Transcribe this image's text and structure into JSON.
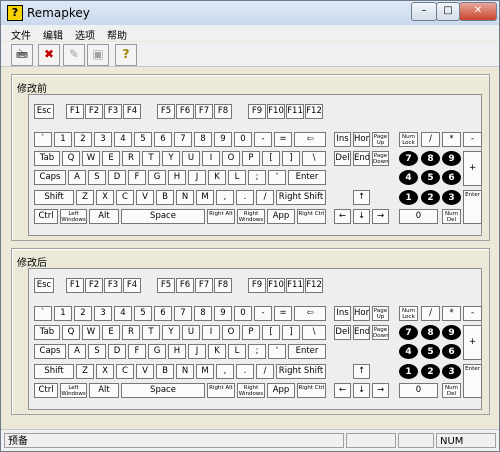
{
  "window": {
    "title": "Remapkey",
    "icon": "remapkey-app-icon",
    "minimize": "–",
    "maximize": "□",
    "close": "✕"
  },
  "menu": [
    "文件",
    "编辑",
    "选项",
    "帮助"
  ],
  "toolbar": [
    {
      "name": "open-keyboard-icon",
      "glyph": "🖮",
      "enabled": true
    },
    {
      "name": "remove-mapping-icon",
      "glyph": "✖",
      "enabled": true
    },
    {
      "name": "write-mapping-icon",
      "glyph": "✎",
      "enabled": false
    },
    {
      "name": "print-icon",
      "glyph": "▣",
      "enabled": false
    },
    {
      "name": "help-icon",
      "glyph": "?",
      "enabled": true
    }
  ],
  "before": {
    "label": "修改前"
  },
  "after": {
    "label": "修改后"
  },
  "status": {
    "text": "预备",
    "num": "NUM"
  },
  "keys": {
    "row0": [
      "Esc",
      "F1",
      "F2",
      "F3",
      "F4",
      "F5",
      "F6",
      "F7",
      "F8",
      "F9",
      "F10",
      "F11",
      "F12"
    ],
    "row1": [
      "`",
      "1",
      "2",
      "3",
      "4",
      "5",
      "6",
      "7",
      "8",
      "9",
      "0",
      "-",
      "=",
      "⇦"
    ],
    "row2": [
      "Tab",
      "Q",
      "W",
      "E",
      "R",
      "T",
      "Y",
      "U",
      "I",
      "O",
      "P",
      "[",
      "]",
      "\\"
    ],
    "row3": [
      "Caps",
      "A",
      "S",
      "D",
      "F",
      "G",
      "H",
      "J",
      "K",
      "L",
      ";",
      "'",
      "Enter"
    ],
    "row4": [
      "Shift",
      "Z",
      "X",
      "C",
      "V",
      "B",
      "N",
      "M",
      ",",
      ".",
      "/",
      "Right Shift"
    ],
    "row5": [
      "Ctrl",
      "Left Windows",
      "Alt",
      "Space",
      "Right Alt",
      "Right Windows",
      "App",
      "Right Ctrl"
    ],
    "nav1": [
      "Ins",
      "Home",
      "Page Up"
    ],
    "nav2": [
      "Del",
      "End",
      "Page Down"
    ],
    "arrows": [
      "↑",
      "←",
      "↓",
      "→"
    ],
    "numpad": {
      "row1": [
        "Num Lock",
        "/",
        "*",
        "-"
      ],
      "row2": [
        "7",
        "8",
        "9",
        "+"
      ],
      "row3": [
        "4",
        "5",
        "6"
      ],
      "row4": [
        "1",
        "2",
        "3",
        "Enter"
      ],
      "row5": [
        "0",
        "Num Del"
      ]
    }
  }
}
